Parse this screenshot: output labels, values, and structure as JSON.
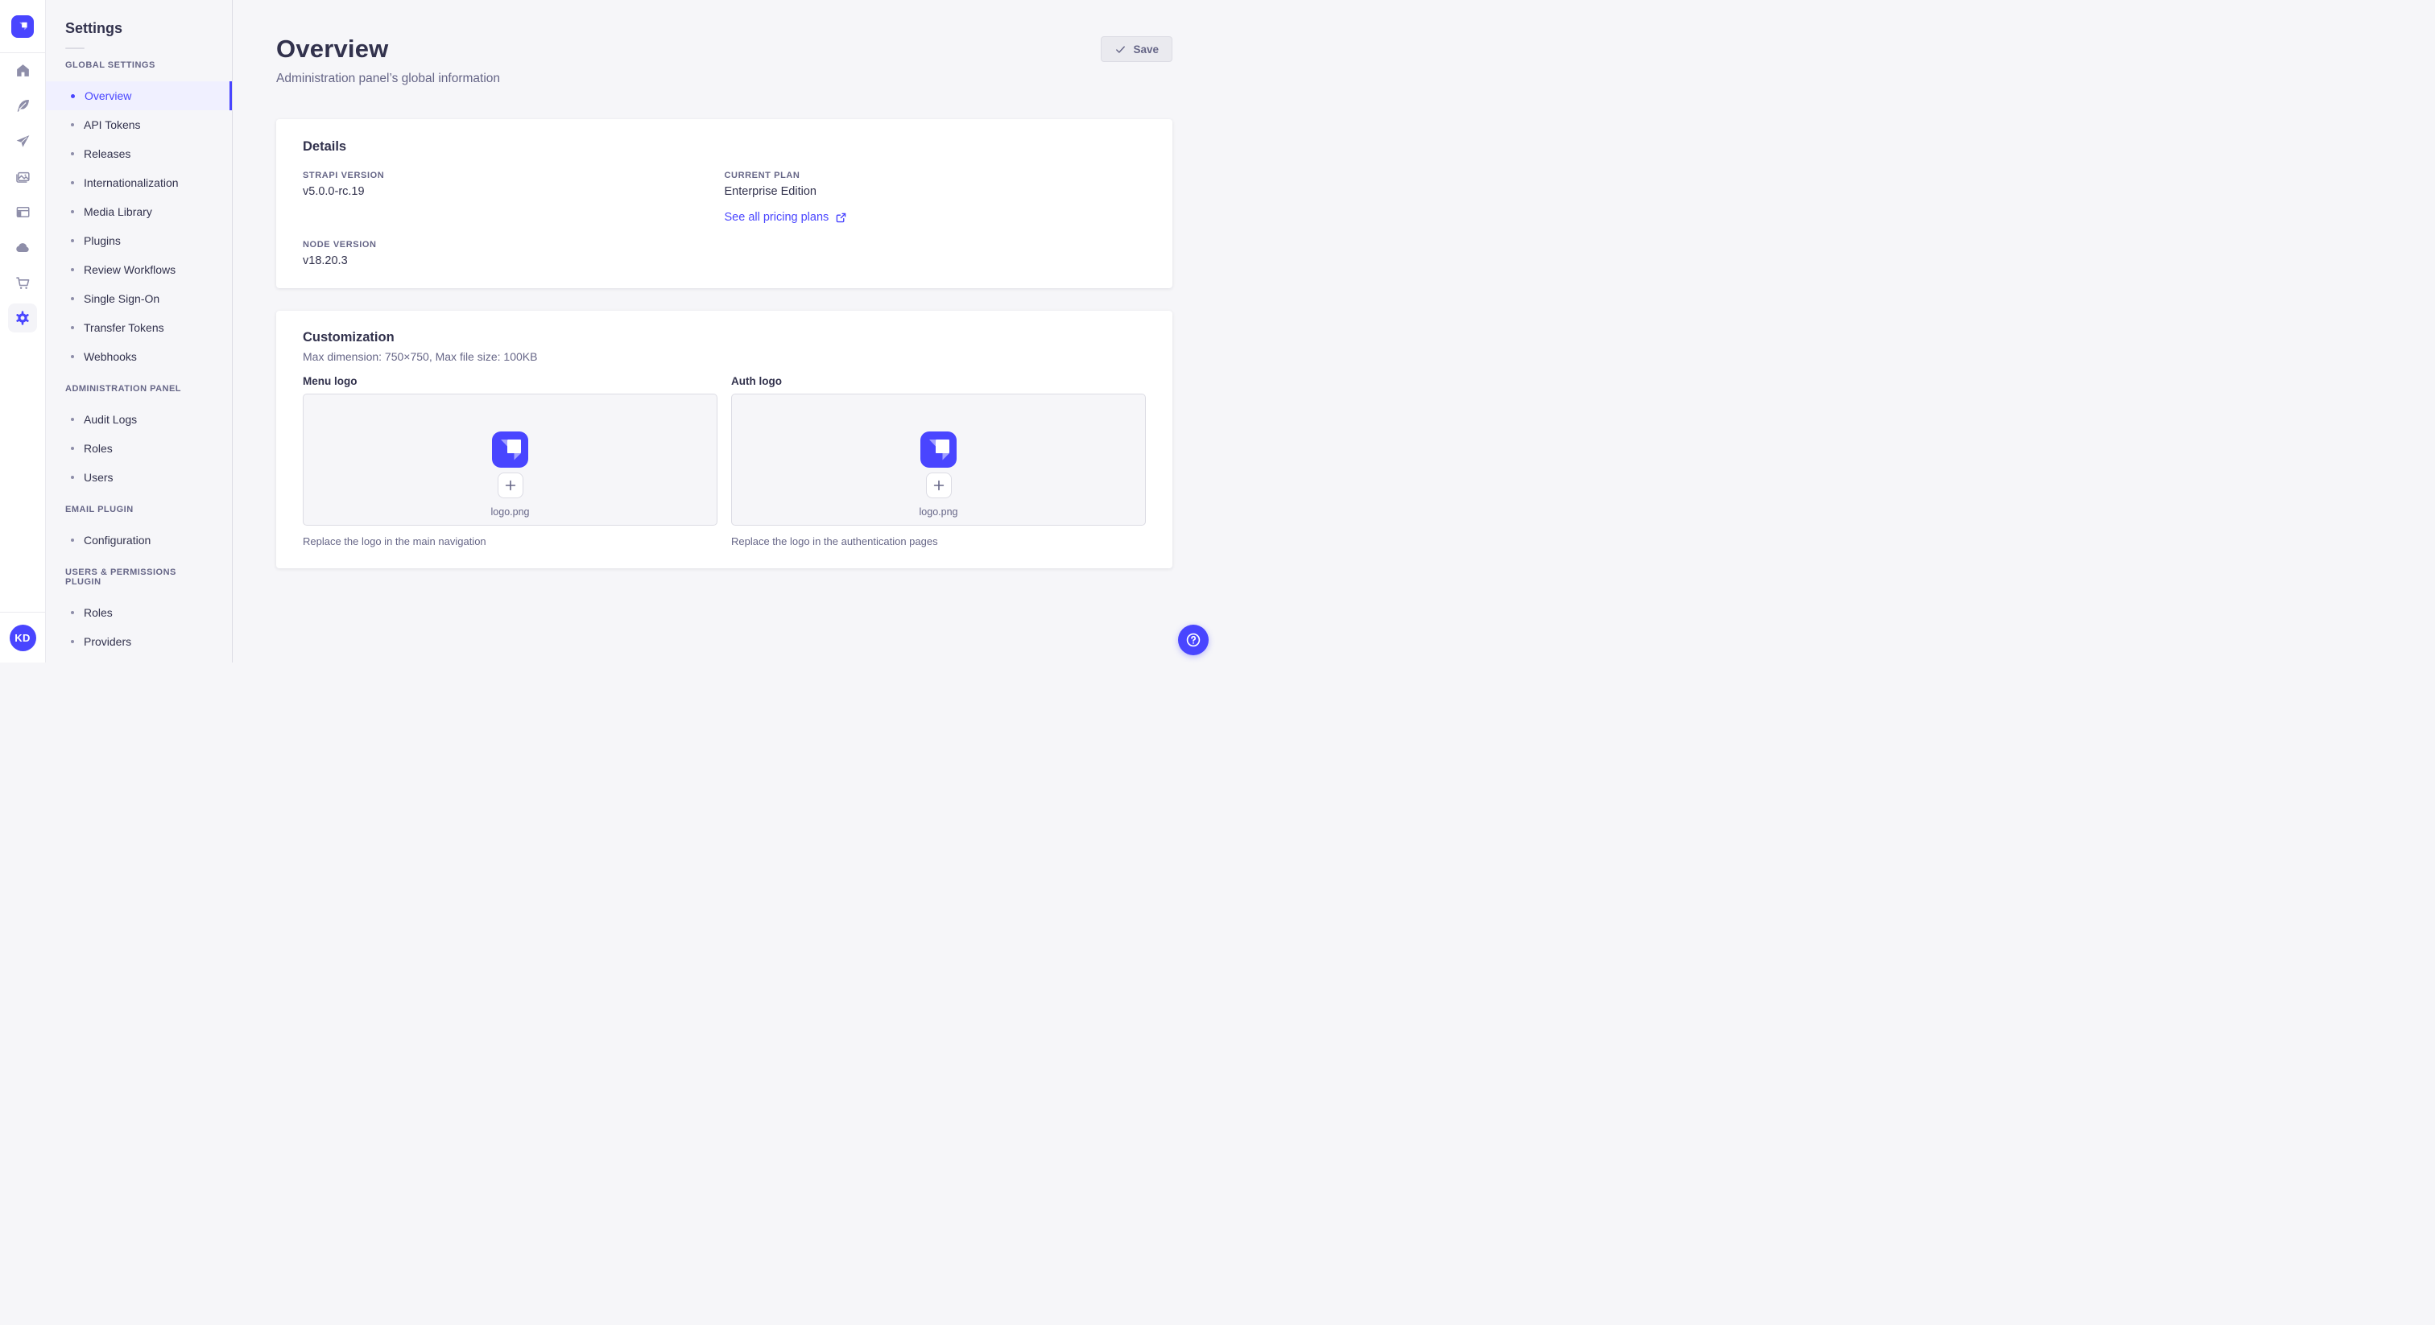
{
  "colors": {
    "primary": "#4945ff",
    "active_item_bg": "#f0f0ff",
    "page_bg": "#f6f6f9",
    "card_bg": "#ffffff",
    "muted_text": "#666687",
    "dark_text": "#32324d",
    "border": "#dcdce4"
  },
  "icon_rail": {
    "logo": "strapi-logo",
    "items": [
      {
        "name": "home"
      },
      {
        "name": "content-type-builder"
      },
      {
        "name": "deploy"
      },
      {
        "name": "media-library"
      },
      {
        "name": "content-manager"
      },
      {
        "name": "cloud"
      },
      {
        "name": "marketplace"
      },
      {
        "name": "settings",
        "active": true
      }
    ],
    "avatar_initials": "KD"
  },
  "subnav": {
    "title": "Settings",
    "sections": [
      {
        "label": "GLOBAL SETTINGS",
        "items": [
          {
            "label": "Overview",
            "active": true
          },
          {
            "label": "API Tokens"
          },
          {
            "label": "Releases"
          },
          {
            "label": "Internationalization"
          },
          {
            "label": "Media Library"
          },
          {
            "label": "Plugins"
          },
          {
            "label": "Review Workflows"
          },
          {
            "label": "Single Sign-On"
          },
          {
            "label": "Transfer Tokens"
          },
          {
            "label": "Webhooks"
          }
        ]
      },
      {
        "label": "ADMINISTRATION PANEL",
        "items": [
          {
            "label": "Audit Logs"
          },
          {
            "label": "Roles"
          },
          {
            "label": "Users"
          }
        ]
      },
      {
        "label": "EMAIL PLUGIN",
        "items": [
          {
            "label": "Configuration"
          }
        ]
      },
      {
        "label": "USERS & PERMISSIONS PLUGIN",
        "items": [
          {
            "label": "Roles"
          },
          {
            "label": "Providers"
          }
        ]
      }
    ]
  },
  "header": {
    "title": "Overview",
    "subtitle": "Administration panel’s global information",
    "save_label": "Save"
  },
  "details_card": {
    "title": "Details",
    "strapi_version": {
      "label": "STRAPI VERSION",
      "value": "v5.0.0-rc.19"
    },
    "node_version": {
      "label": "NODE VERSION",
      "value": "v18.20.3"
    },
    "current_plan": {
      "label": "CURRENT PLAN",
      "value": "Enterprise Edition"
    },
    "pricing_link": "See all pricing plans"
  },
  "customization_card": {
    "title": "Customization",
    "subtitle": "Max dimension: 750×750, Max file size: 100KB",
    "uploads": [
      {
        "label": "Menu logo",
        "file_name": "logo.png",
        "hint": "Replace the logo in the main navigation"
      },
      {
        "label": "Auth logo",
        "file_name": "logo.png",
        "hint": "Replace the logo in the authentication pages"
      }
    ]
  }
}
